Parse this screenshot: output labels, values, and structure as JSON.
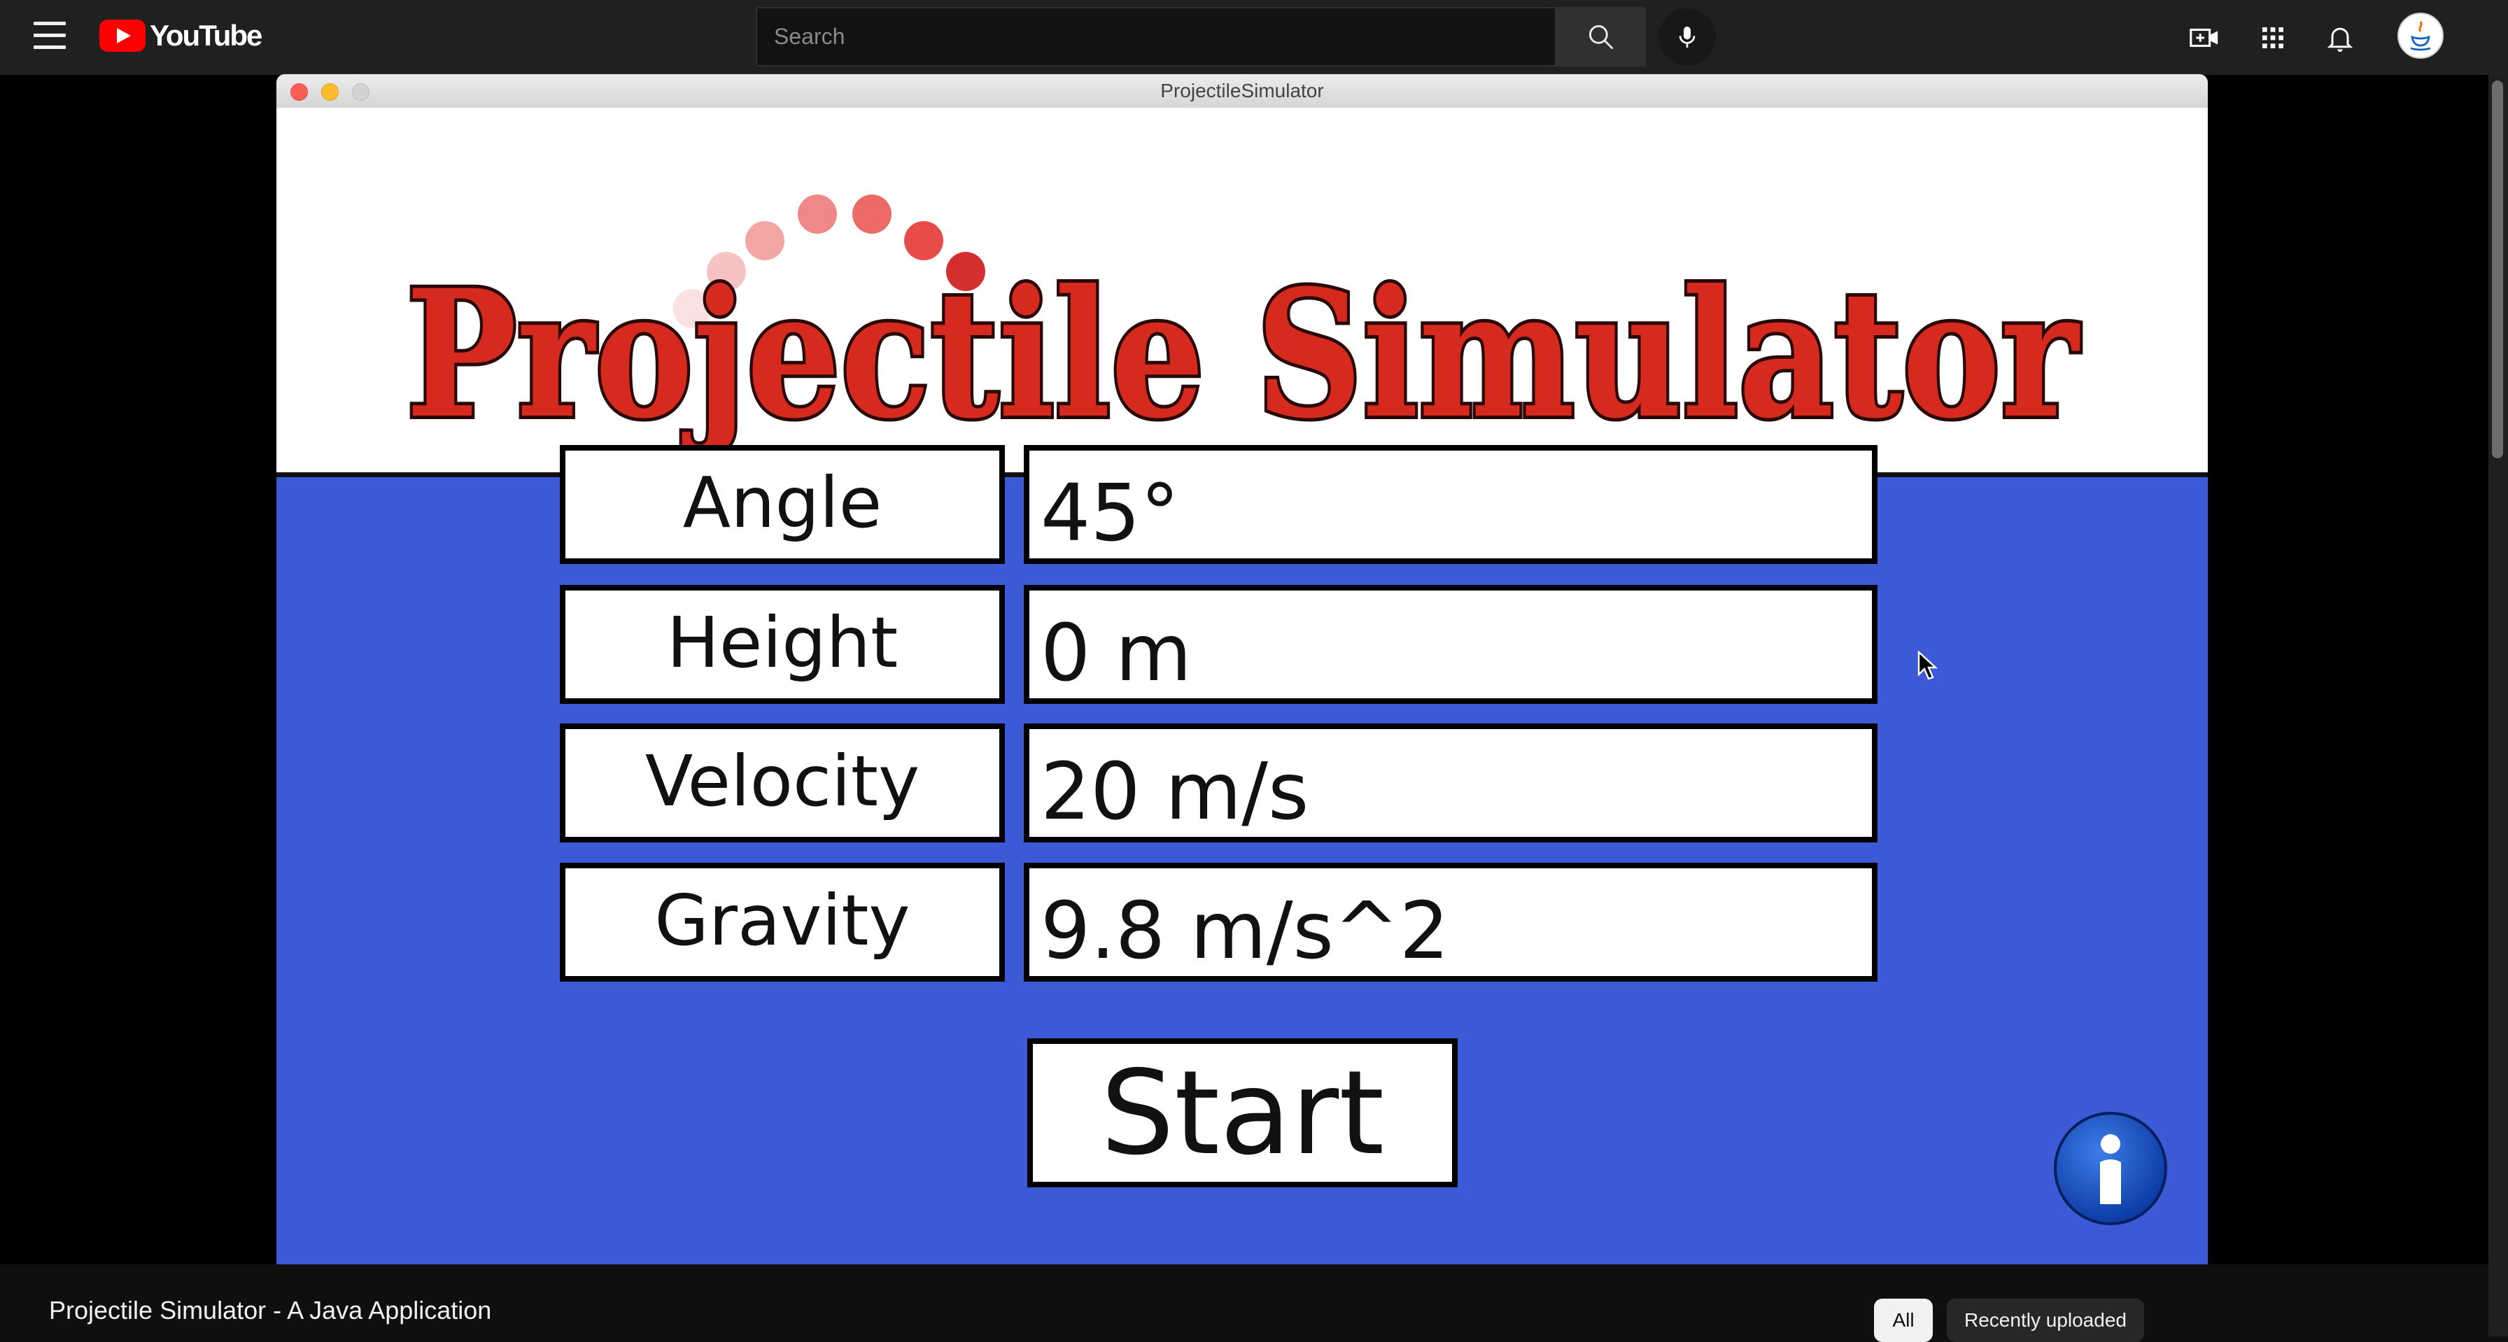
{
  "youtube": {
    "logo_text": "YouTube",
    "search_placeholder": "Search",
    "icons": [
      "menu-icon",
      "search-icon",
      "mic-icon",
      "create-video-icon",
      "apps-grid-icon",
      "notifications-bell-icon",
      "avatar"
    ]
  },
  "app_window": {
    "title": "ProjectileSimulator",
    "banner_title": "Projectile Simulator",
    "fields": [
      {
        "label": "Angle",
        "value": "45°"
      },
      {
        "label": "Height",
        "value": "0 m"
      },
      {
        "label": "Velocity",
        "value": "20 m/s"
      },
      {
        "label": "Gravity",
        "value": "9.8 m/s^2"
      }
    ],
    "start_label": "Start",
    "info_icon": "info-icon",
    "colors": {
      "background": "#3c5ad6",
      "title_red": "#d62a1e"
    }
  },
  "video": {
    "title": "Projectile Simulator - A Java Application"
  },
  "chips": {
    "all": "All",
    "recently_uploaded": "Recently uploaded"
  }
}
